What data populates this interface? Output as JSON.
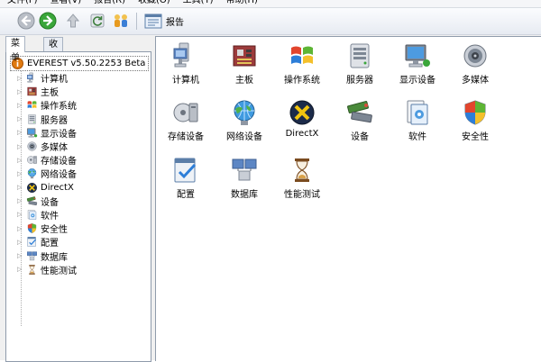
{
  "menu": [
    "文件(F)",
    "查看(V)",
    "报告(R)",
    "收藏(O)",
    "工具(T)",
    "帮助(H)"
  ],
  "toolbar": {
    "buttons": [
      {
        "name": "back-button",
        "icon": "back-arrow-icon"
      },
      {
        "name": "forward-button",
        "icon": "forward-arrow-icon"
      },
      {
        "name": "up-button",
        "icon": "up-arrow-icon"
      },
      {
        "name": "refresh-button",
        "icon": "refresh-icon"
      },
      {
        "name": "users-button",
        "icon": "users-icon"
      }
    ],
    "report_label": "报告"
  },
  "tabs": {
    "menu": "菜单",
    "favorites": "收藏夹"
  },
  "tree": {
    "root": "EVEREST v5.50.2253 Beta",
    "items": [
      {
        "label": "计算机",
        "icon": "computer-icon"
      },
      {
        "label": "主板",
        "icon": "motherboard-icon"
      },
      {
        "label": "操作系统",
        "icon": "windows-logo-icon"
      },
      {
        "label": "服务器",
        "icon": "server-icon"
      },
      {
        "label": "显示设备",
        "icon": "display-icon"
      },
      {
        "label": "多媒体",
        "icon": "speaker-icon"
      },
      {
        "label": "存储设备",
        "icon": "storage-icon"
      },
      {
        "label": "网络设备",
        "icon": "network-icon"
      },
      {
        "label": "DirectX",
        "icon": "directx-icon"
      },
      {
        "label": "设备",
        "icon": "devices-icon"
      },
      {
        "label": "软件",
        "icon": "software-icon"
      },
      {
        "label": "安全性",
        "icon": "shield-icon"
      },
      {
        "label": "配置",
        "icon": "config-icon"
      },
      {
        "label": "数据库",
        "icon": "database-icon"
      },
      {
        "label": "性能测试",
        "icon": "hourglass-icon"
      }
    ]
  },
  "grid": [
    {
      "label": "计算机",
      "icon": "computer-icon"
    },
    {
      "label": "主板",
      "icon": "motherboard-icon"
    },
    {
      "label": "操作系统",
      "icon": "windows-logo-icon"
    },
    {
      "label": "服务器",
      "icon": "server-icon"
    },
    {
      "label": "显示设备",
      "icon": "display-icon"
    },
    {
      "label": "多媒体",
      "icon": "speaker-icon"
    },
    {
      "label": "存储设备",
      "icon": "storage-icon"
    },
    {
      "label": "网络设备",
      "icon": "network-icon"
    },
    {
      "label": "DirectX",
      "icon": "directx-icon"
    },
    {
      "label": "设备",
      "icon": "devices-icon"
    },
    {
      "label": "软件",
      "icon": "software-icon"
    },
    {
      "label": "安全性",
      "icon": "shield-icon"
    },
    {
      "label": "配置",
      "icon": "config-icon"
    },
    {
      "label": "数据库",
      "icon": "database-icon"
    },
    {
      "label": "性能测试",
      "icon": "hourglass-icon"
    }
  ]
}
